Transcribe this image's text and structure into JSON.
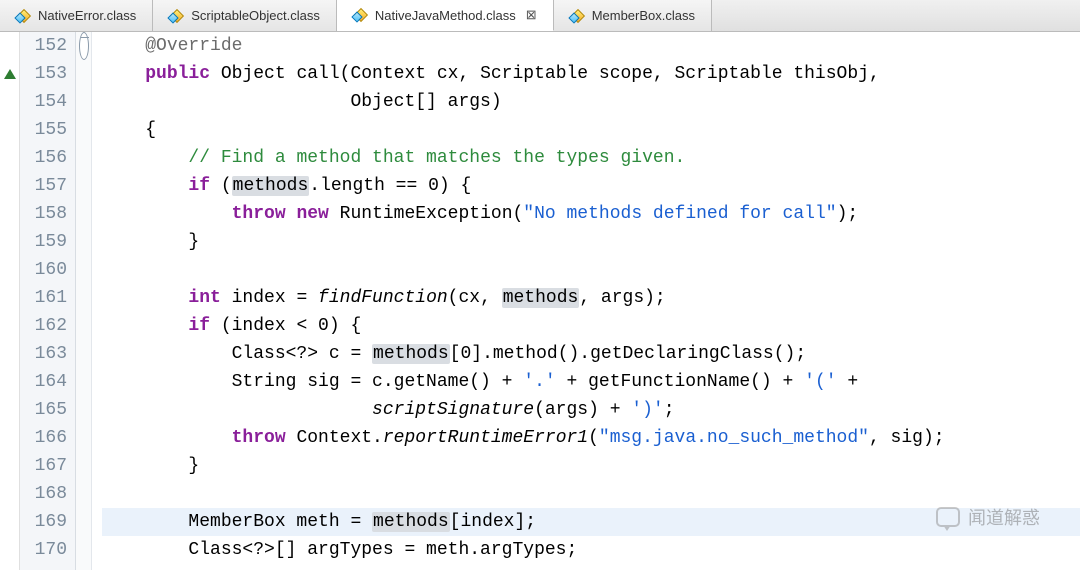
{
  "tabs": [
    {
      "label": "NativeError.class",
      "active": false
    },
    {
      "label": "ScriptableObject.class",
      "active": false
    },
    {
      "label": "NativeJavaMethod.class",
      "active": true
    },
    {
      "label": "MemberBox.class",
      "active": false
    }
  ],
  "close_glyph": "⊠",
  "watermark_text": "闻道解惑",
  "line_start": 152,
  "line_end": 170,
  "gutter": {
    "152": "fold-minus",
    "153": "tri-up"
  },
  "highlighted_line": 169,
  "highlighted_refs": "methods",
  "code_lines": {
    "152": [
      [
        "    ",
        ""
      ],
      [
        "@Override",
        "ann"
      ]
    ],
    "153": [
      [
        "    ",
        ""
      ],
      [
        "public",
        "kw"
      ],
      [
        " Object call(Context cx, Scriptable scope, Scriptable thisObj,",
        ""
      ]
    ],
    "154": [
      [
        "                       Object[] args)",
        ""
      ]
    ],
    "155": [
      [
        "    {",
        ""
      ]
    ],
    "156": [
      [
        "        ",
        ""
      ],
      [
        "// Find a method that matches the types given.",
        "com"
      ]
    ],
    "157": [
      [
        "        ",
        ""
      ],
      [
        "if",
        "kw"
      ],
      [
        " (",
        ""
      ],
      [
        "methods",
        "hi"
      ],
      [
        ".length == 0) {",
        ""
      ]
    ],
    "158": [
      [
        "            ",
        ""
      ],
      [
        "throw",
        "kw"
      ],
      [
        " ",
        ""
      ],
      [
        "new",
        "kw"
      ],
      [
        " RuntimeException(",
        ""
      ],
      [
        "\"No methods defined for call\"",
        "str"
      ],
      [
        ");",
        ""
      ]
    ],
    "159": [
      [
        "        }",
        ""
      ]
    ],
    "160": [
      [
        "",
        ""
      ]
    ],
    "161": [
      [
        "        ",
        ""
      ],
      [
        "int",
        "kw"
      ],
      [
        " index = ",
        ""
      ],
      [
        "findFunction",
        "it"
      ],
      [
        "(cx, ",
        ""
      ],
      [
        "methods",
        "hi"
      ],
      [
        ", args);",
        ""
      ]
    ],
    "162": [
      [
        "        ",
        ""
      ],
      [
        "if",
        "kw"
      ],
      [
        " (index < 0) {",
        ""
      ]
    ],
    "163": [
      [
        "            Class<?> c = ",
        ""
      ],
      [
        "methods",
        "hi"
      ],
      [
        "[0].method().getDeclaringClass();",
        ""
      ]
    ],
    "164": [
      [
        "            String sig = c.getName() + ",
        ""
      ],
      [
        "'.'",
        "chr"
      ],
      [
        " + getFunctionName() + ",
        ""
      ],
      [
        "'('",
        "chr"
      ],
      [
        " +",
        ""
      ]
    ],
    "165": [
      [
        "                         ",
        ""
      ],
      [
        "scriptSignature",
        "it"
      ],
      [
        "(args) + ",
        ""
      ],
      [
        "')'",
        "chr"
      ],
      [
        ";",
        ""
      ]
    ],
    "166": [
      [
        "            ",
        ""
      ],
      [
        "throw",
        "kw"
      ],
      [
        " Context.",
        ""
      ],
      [
        "reportRuntimeError1",
        "it"
      ],
      [
        "(",
        ""
      ],
      [
        "\"msg.java.no_such_method\"",
        "str"
      ],
      [
        ", sig);",
        ""
      ]
    ],
    "167": [
      [
        "        }",
        ""
      ]
    ],
    "168": [
      [
        "",
        ""
      ]
    ],
    "169": [
      [
        "        MemberBox meth = ",
        ""
      ],
      [
        "methods",
        "hi"
      ],
      [
        "[index];",
        ""
      ]
    ],
    "170": [
      [
        "        Class<?>[] argTypes = meth.argTypes;",
        ""
      ]
    ]
  }
}
